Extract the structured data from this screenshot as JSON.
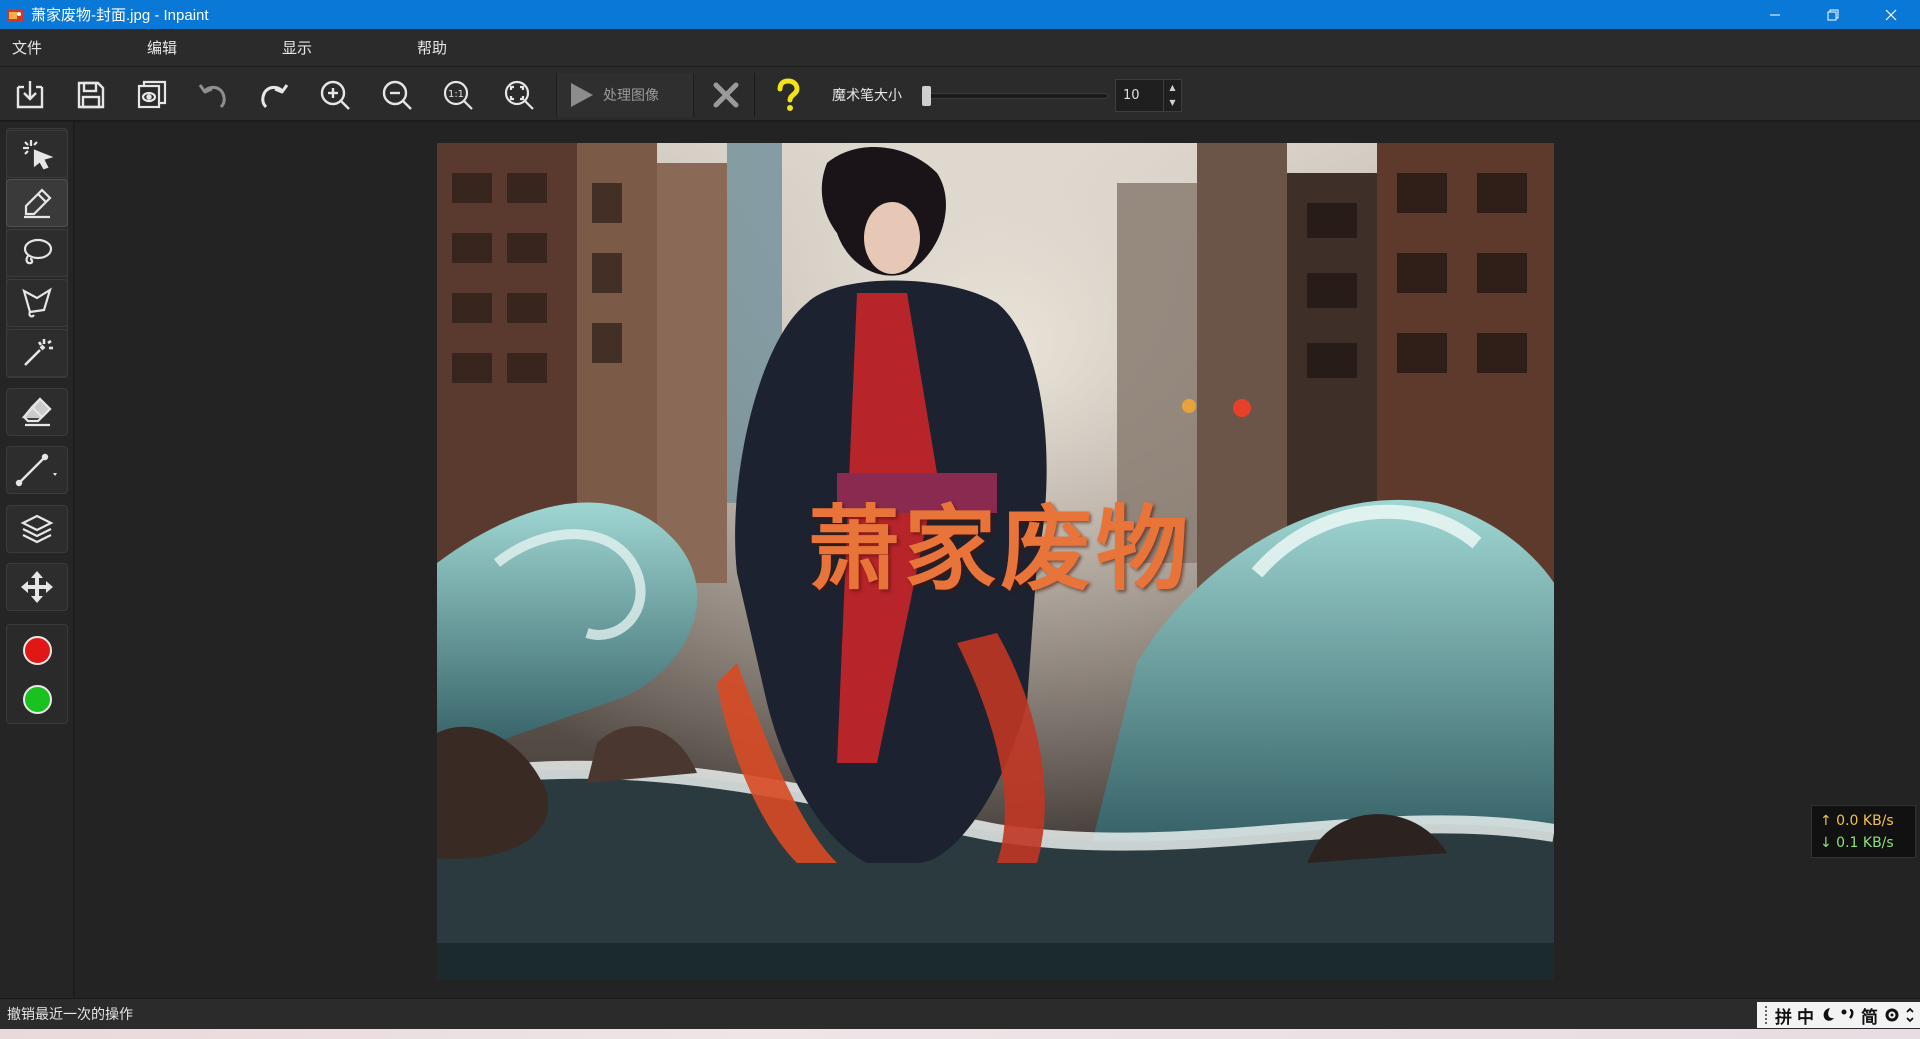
{
  "window": {
    "title": "萧家废物-封面.jpg - Inpaint",
    "controls": [
      "minimize",
      "restore",
      "close"
    ]
  },
  "menu": {
    "items": [
      "文件",
      "编辑",
      "显示",
      "帮助"
    ]
  },
  "toolbar": {
    "buttons": [
      "open-icon",
      "save-icon",
      "preview-icon",
      "undo-icon",
      "redo-icon",
      "zoom-in-icon",
      "zoom-out-icon",
      "actual-size-icon",
      "fit-to-window-icon"
    ],
    "actual_size_label": "1:1",
    "process_label": "处理图像",
    "brush_size_label": "魔术笔大小",
    "brush_size_value": "10"
  },
  "tools": {
    "items": [
      "smart-select-icon",
      "marker-icon",
      "lasso-icon",
      "polygon-lasso-icon",
      "magic-wand-icon",
      "eraser-icon",
      "line-icon",
      "layers-icon",
      "move-icon"
    ],
    "colors": {
      "mask": "#e11717",
      "guide": "#19c21e"
    }
  },
  "canvas": {
    "overlay_text": "萧家废物",
    "text_color": "#e8743a"
  },
  "network": {
    "upload": "↑ 0.0 KB/s",
    "download": "↓ 0.1 KB/s"
  },
  "status": {
    "message": "撤销最近一次的操作"
  },
  "ime": {
    "items": [
      "拼",
      "中",
      "简"
    ]
  }
}
